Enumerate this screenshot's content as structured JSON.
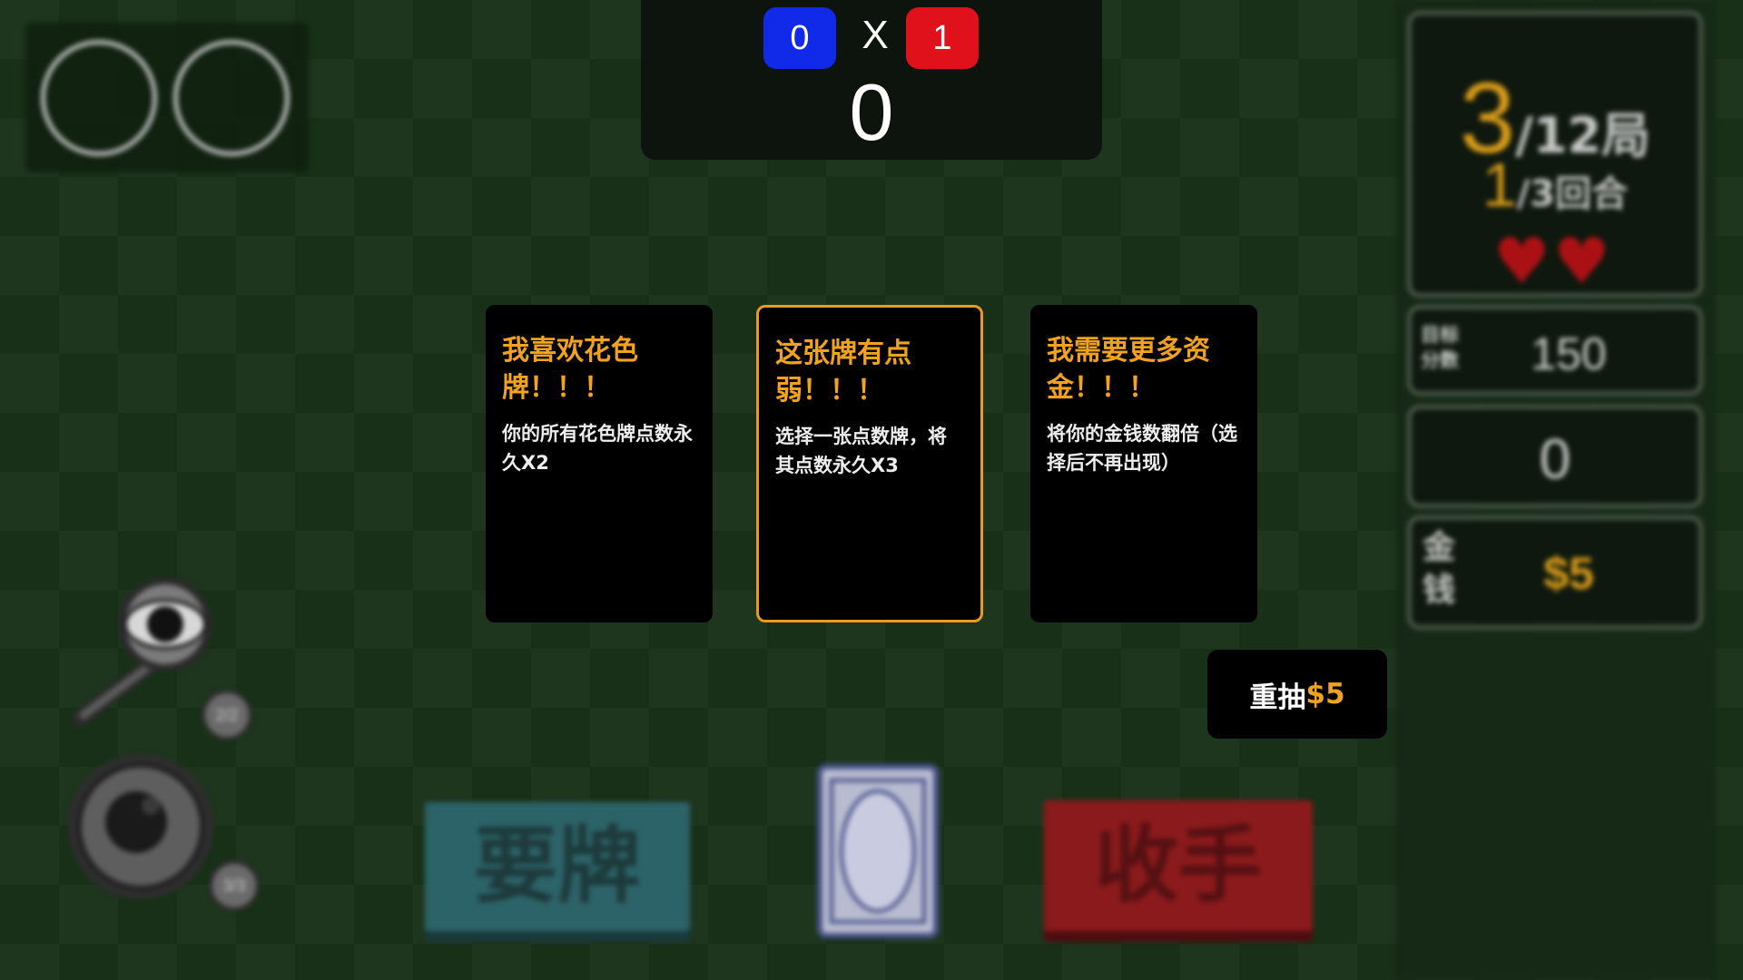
{
  "scoreboard": {
    "blue_score": "0",
    "vs": "X",
    "red_score": "1",
    "current_points": "0"
  },
  "panel": {
    "round_current": "3",
    "round_rest": "/12局",
    "hand_current": "1",
    "hand_rest": "/3回合",
    "lives": 2,
    "target_label": "目标\n分数",
    "target_value": "150",
    "score_value": "0",
    "money_label": "金\n钱",
    "money_value": "$5"
  },
  "choices": [
    {
      "title": "我喜欢花色牌！！！",
      "desc": "你的所有花色牌点数永久X2"
    },
    {
      "title": "这张牌有点弱！！！",
      "desc": "选择一张点数牌，将其点数永久X3"
    },
    {
      "title": "我需要更多资金！！！",
      "desc": "将你的金钱数翻倍（选择后不再出现）"
    }
  ],
  "reroll": {
    "label": "重抽",
    "price": "$5"
  },
  "tools": {
    "magnifier_uses": "2/2",
    "bomb_uses": "3/3"
  },
  "actions": {
    "hit_label": "要牌",
    "stand_label": "收手"
  },
  "colors": {
    "accent_orange": "#f1a21f",
    "blue_team": "#1129e8",
    "red_team": "#e0111b",
    "heart": "#b31014"
  },
  "icons": {
    "magnifier": "magnifier-icon",
    "bomb": "bomb-icon",
    "heart": "heart-icon"
  }
}
